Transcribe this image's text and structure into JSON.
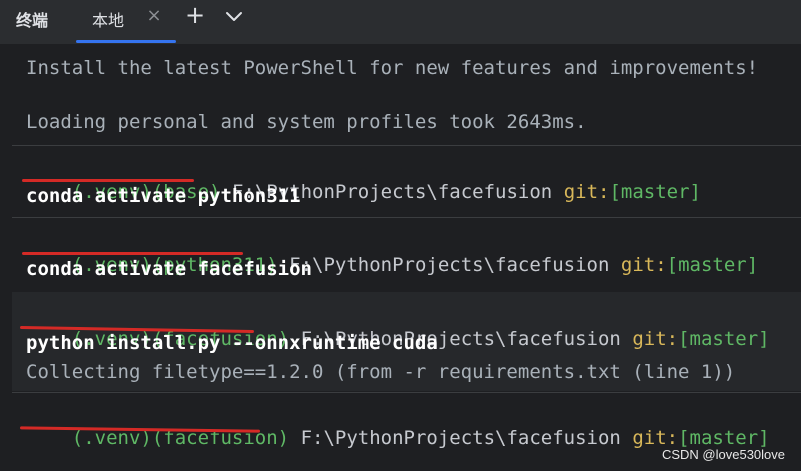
{
  "toolwindow": {
    "title": "终端"
  },
  "tabs": [
    {
      "label": "本地",
      "close_icon": "close-icon",
      "active": true
    }
  ],
  "tabbar": {
    "add_icon": "plus-icon",
    "more_icon": "chevron-down-icon"
  },
  "terminal": {
    "banner": [
      "Install the latest PowerShell for new features and improvements!",
      "Loading personal and system profiles took 2643ms."
    ],
    "blocks": [
      {
        "env": "(.venv)(base)",
        "path": "F:\\PythonProjects\\facefusion",
        "git_label": "git:",
        "branch": "[master]",
        "command": "conda activate python311"
      },
      {
        "env": "(.venv)(python311)",
        "path": "F:\\PythonProjects\\facefusion",
        "git_label": "git:",
        "branch": "[master]",
        "command": "conda activate facefusion"
      },
      {
        "env": "(.venv)(facefusion)",
        "path": "F:\\PythonProjects\\facefusion",
        "git_label": "git:",
        "branch": "[master]",
        "command": "python install.py --onnxruntime cuda",
        "output": "Collecting filetype==1.2.0 (from -r requirements.txt (line 1))"
      },
      {
        "env": "(.venv)(facefusion)",
        "path": "F:\\PythonProjects\\facefusion",
        "git_label": "git:",
        "branch": "[master]"
      }
    ]
  },
  "watermark": "CSDN @love530love",
  "colors": {
    "background": "#1e1f22",
    "env_green": "#5fb865",
    "git_yellow": "#d9b85a",
    "annotation_red": "#d42a26",
    "active_tab_accent": "#3574f0"
  }
}
